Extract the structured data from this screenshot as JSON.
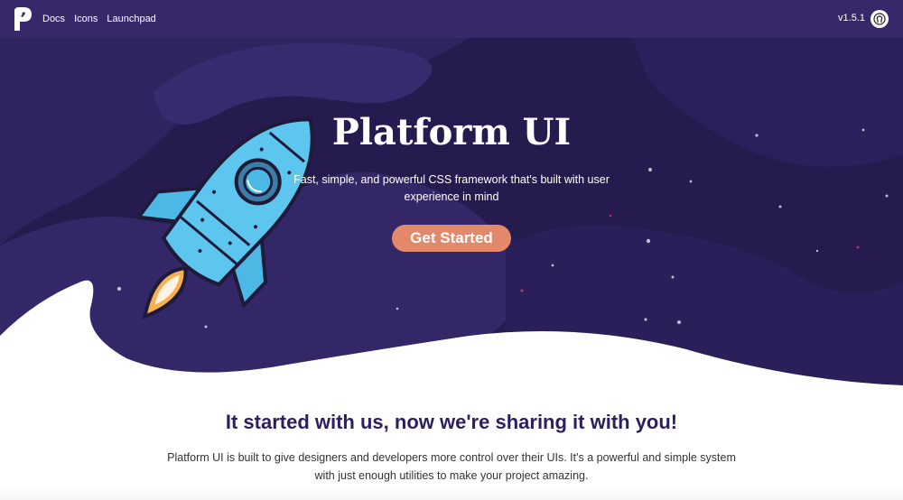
{
  "nav": {
    "links": [
      "Docs",
      "Icons",
      "Launchpad"
    ],
    "version": "v1.5.1"
  },
  "hero": {
    "title": "Platform UI",
    "subtitle_line1": "Fast, simple, and powerful CSS framework that's built with user",
    "subtitle_line2": "experience in mind",
    "cta": "Get Started"
  },
  "content": {
    "heading": "It started with us, now we're sharing it with you!",
    "body_line1": "Platform UI is built to give designers and developers more control over their UIs. It's a powerful and simple system",
    "body_line2": "with just enough utilities to make your project amazing."
  },
  "colors": {
    "nav_bg": "#37286a",
    "hero_dark": "#231a4c",
    "hero_wave": "#382a6e",
    "cta_bg": "#e3896a",
    "heading": "#2c1e5f"
  }
}
